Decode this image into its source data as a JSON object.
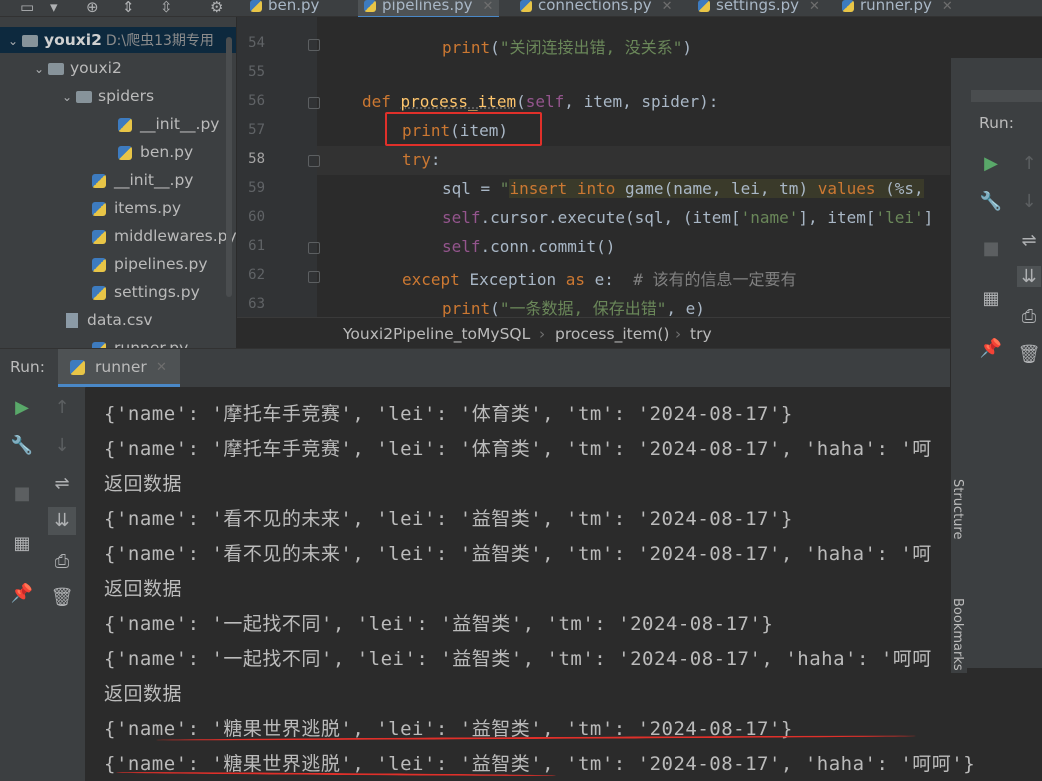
{
  "tabs": [
    {
      "label": "ben.py",
      "active": false
    },
    {
      "label": "pipelines.py",
      "active": true
    },
    {
      "label": "connections.py",
      "active": false
    },
    {
      "label": "settings.py",
      "active": false
    },
    {
      "label": "runner.py",
      "active": false
    }
  ],
  "tree": {
    "root_name": "youxi2",
    "root_path": "D:\\爬虫13期专用",
    "items": [
      {
        "label": "youxi2"
      },
      {
        "label": "spiders"
      },
      {
        "label": "__init__.py"
      },
      {
        "label": "ben.py"
      },
      {
        "label": "__init__.py"
      },
      {
        "label": "items.py"
      },
      {
        "label": "middlewares.py"
      },
      {
        "label": "pipelines.py"
      },
      {
        "label": "settings.py"
      },
      {
        "label": "data.csv"
      },
      {
        "label": "runner.py"
      }
    ]
  },
  "editor": {
    "line_numbers": [
      "54",
      "55",
      "56",
      "57",
      "58",
      "59",
      "60",
      "61",
      "62",
      "63"
    ],
    "l54": {
      "print": "print",
      "str": "\"关闭连接出错, 没关系\"",
      "close": ")",
      "open": "("
    },
    "l56": {
      "def": "def ",
      "fn": "process_item",
      "open": "(",
      "self": "self",
      "rest": ", item, spider):"
    },
    "l57": {
      "print": "print",
      "rest": "(item)"
    },
    "l58": {
      "try": "try",
      ":": ":"
    },
    "l59": {
      "a": "sql = ",
      "q": "\"",
      "ins": "insert into ",
      "b": "game(",
      "c": "name, lei, tm",
      "d": ") ",
      "val": "values ",
      "e": "(%s,"
    },
    "l60": {
      "self": "self",
      "a": ".cursor.execute(sql, (item[",
      "s1": "'name'",
      "b": "], item[",
      "s2": "'lei'",
      "c": "]"
    },
    "l61": {
      "self": "self",
      "a": ".conn.commit()"
    },
    "l62": {
      "exc": "except ",
      "cls": "Exception ",
      "as": "as ",
      "e": "e:  ",
      "cmt": "# 该有的信息一定要有"
    },
    "l63": {
      "print": "print",
      "open": "(",
      "str": "\"一条数据, 保存出错\"",
      "rest": ", e)"
    }
  },
  "breadcrumb": [
    "Youxi2Pipeline_toMySQL",
    "process_item()",
    "try"
  ],
  "run": {
    "label": "Run:",
    "tab": "runner",
    "right_label": "Run:"
  },
  "side_labels": {
    "structure": "Structure",
    "bookmarks": "Bookmarks"
  },
  "console_lines": [
    "{'name': '摩托车手竞赛', 'lei': '体育类', 'tm': '2024-08-17'}",
    "{'name': '摩托车手竞赛', 'lei': '体育类', 'tm': '2024-08-17', 'haha': '呵",
    "返回数据",
    "{'name': '看不见的未来', 'lei': '益智类', 'tm': '2024-08-17'}",
    "{'name': '看不见的未来', 'lei': '益智类', 'tm': '2024-08-17', 'haha': '呵",
    "返回数据",
    "{'name': '一起找不同', 'lei': '益智类', 'tm': '2024-08-17'}",
    "{'name': '一起找不同', 'lei': '益智类', 'tm': '2024-08-17', 'haha': '呵呵",
    "返回数据",
    "{'name': '糖果世界逃脱', 'lei': '益智类', 'tm': '2024-08-17'}",
    "{'name': '糖果世界逃脱', 'lei': '益智类', 'tm': '2024-08-17', 'haha': '呵呵'}"
  ],
  "colors": {
    "annotation": "#e0302a",
    "keyword": "#cc7832",
    "string": "#6a8759",
    "function": "#ffc66d",
    "run_green": "#59a869"
  },
  "icons": [
    "python-file-icon",
    "folder-icon",
    "run-icon",
    "wrench-icon",
    "stop-icon",
    "soft-wrap-icon",
    "scroll-to-end-icon",
    "print-icon",
    "trash-icon",
    "pin-icon",
    "up-arrow-icon",
    "down-arrow-icon",
    "layout-icon"
  ]
}
